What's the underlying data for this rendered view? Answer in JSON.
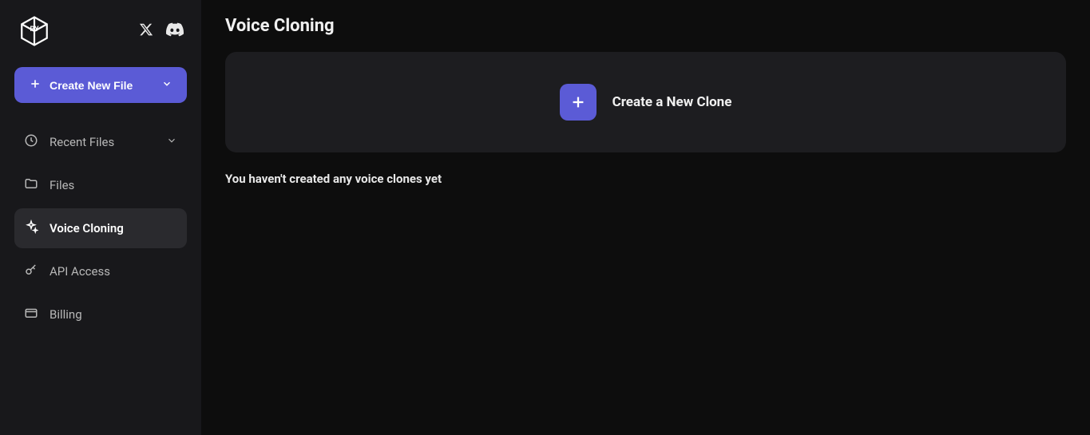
{
  "sidebar": {
    "create_button_label": "Create New File",
    "nav": [
      {
        "label": "Recent Files",
        "icon": "clock-icon",
        "expandable": true,
        "active": false
      },
      {
        "label": "Files",
        "icon": "folder-icon",
        "expandable": false,
        "active": false
      },
      {
        "label": "Voice Cloning",
        "icon": "sparkle-icon",
        "expandable": false,
        "active": true
      },
      {
        "label": "API Access",
        "icon": "key-icon",
        "expandable": false,
        "active": false
      },
      {
        "label": "Billing",
        "icon": "card-icon",
        "expandable": false,
        "active": false
      }
    ]
  },
  "main": {
    "page_title": "Voice Cloning",
    "create_clone_label": "Create a New Clone",
    "empty_message": "You haven't created any voice clones yet"
  },
  "colors": {
    "accent": "#5b5bd6",
    "sidebar_bg": "#18181b",
    "main_bg": "#0d0d0d",
    "card_bg": "#1d1d20"
  }
}
